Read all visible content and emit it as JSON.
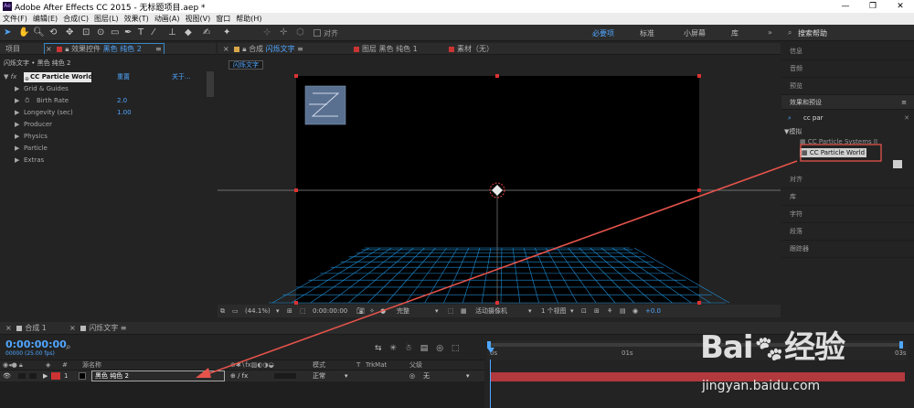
{
  "titlebar": {
    "title": "Adobe After Effects CC 2015 - 无标题项目.aep *",
    "ae_icon": "Ae",
    "minimize": "—",
    "maximize": "❐",
    "close": "✕"
  },
  "menu": [
    "文件(F)",
    "编辑(E)",
    "合成(C)",
    "图层(L)",
    "效果(T)",
    "动画(A)",
    "视图(V)",
    "窗口",
    "帮助(H)"
  ],
  "toolbar": {
    "align_label": "对齐",
    "workspaces": [
      "必要项",
      "标准",
      "小屏幕",
      "库"
    ],
    "search_help": "搜索帮助"
  },
  "left_tabs": {
    "project": "项目",
    "effect_controls": "效果控件",
    "layer_name": "黑色 纯色 2",
    "menu": "≡"
  },
  "effect_controls": {
    "breadcrumb": "闪烁文字 • 黑色 纯色 2",
    "effect_name": "CC Particle World",
    "reset_label": "重置",
    "about_label": "关于...",
    "rows": [
      {
        "label": "Grid & Guides",
        "value": ""
      },
      {
        "label": "Birth Rate",
        "value": "2.0"
      },
      {
        "label": "Longevity (sec)",
        "value": "1.00"
      },
      {
        "label": "Producer",
        "value": ""
      },
      {
        "label": "Physics",
        "value": ""
      },
      {
        "label": "Particle",
        "value": ""
      },
      {
        "label": "Extras",
        "value": ""
      }
    ]
  },
  "viewer_tabs": {
    "comp_prefix": "合成",
    "comp_name": "闪烁文字",
    "layer_tab": "图层 黑色 纯色 1",
    "footage_tab": "素材（无）",
    "menu": "≡",
    "close": "×",
    "comp_chip": "闪烁文字"
  },
  "viewer_footer": {
    "zoom": "(44.1%)",
    "timecode": "0:00:00:00",
    "quality": "完整",
    "camera": "活动摄像机",
    "views": "1 个视图",
    "exposure": "+0.0"
  },
  "right_panel": {
    "info": "信息",
    "audio": "音频",
    "preview": "预览",
    "effects_presets": "效果和预设",
    "search_value": "cc par",
    "category": "▼模拟",
    "effect_items": [
      "CC Particle Systems II",
      "CC Particle World"
    ],
    "below": [
      "对齐",
      "库",
      "字符",
      "段落",
      "跟踪器"
    ],
    "menu": "≡"
  },
  "timeline": {
    "tab1": "合成 1",
    "tab2": "闪烁文字",
    "menu": "≡",
    "close": "×",
    "timecode": "0:00:00:00",
    "fps": "00000 (25.00 fps)",
    "search_icon": "⌕",
    "headers": {
      "num": "#",
      "source": "源名称",
      "mode": "模式",
      "t": "T",
      "trkmat": "TrkMat",
      "parent": "父级"
    },
    "layer": {
      "index": "1",
      "name": "黑色 纯色 2",
      "mode": "正常",
      "parent": "无"
    },
    "ruler": [
      "0s",
      "01s",
      "03s"
    ]
  },
  "colors": {
    "accent_blue": "#4fa6ff",
    "annotation_red": "#e5534b",
    "layer_bar": "#b2393e",
    "grid": "#1e8fd8"
  }
}
